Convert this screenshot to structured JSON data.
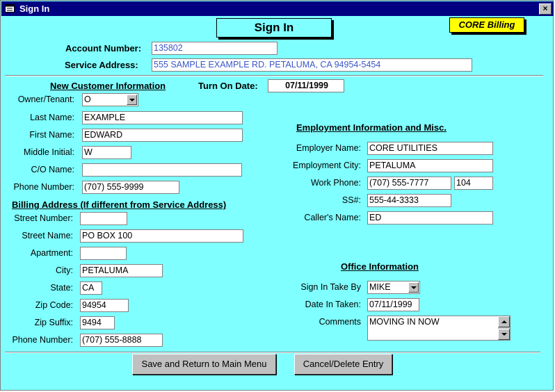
{
  "window": {
    "title": "Sign In",
    "close_glyph": "×",
    "app_icon": "form-icon"
  },
  "form": {
    "title": "Sign In",
    "badge": "CORE Billing"
  },
  "account": {
    "account_number_label": "Account Number:",
    "account_number": "135802",
    "service_address_label": "Service Address:",
    "service_address": "555 SAMPLE EXAMPLE RD. PETALUMA, CA  94954-5454"
  },
  "customer": {
    "heading": "New Customer Information",
    "turn_on_label": "Turn On Date:",
    "turn_on_date": "07/11/1999",
    "owner_tenant_label": "Owner/Tenant:",
    "owner_tenant": "O",
    "last_name_label": "Last Name:",
    "last_name": "EXAMPLE",
    "first_name_label": "First Name:",
    "first_name": "EDWARD",
    "middle_initial_label": "Middle Initial:",
    "middle_initial": "W",
    "co_name_label": "C/O Name:",
    "co_name": "",
    "phone_label": "Phone Number:",
    "phone": "(707) 555-9999"
  },
  "billing": {
    "heading": "Billing Address (If different from Service Address)",
    "street_number_label": "Street Number:",
    "street_number": "",
    "street_name_label": "Street Name:",
    "street_name": "PO BOX 100",
    "apartment_label": "Apartment:",
    "apartment": "",
    "city_label": "City:",
    "city": "PETALUMA",
    "state_label": "State:",
    "state": "CA",
    "zip_label": "Zip Code:",
    "zip": "94954",
    "zip_suffix_label": "Zip Suffix:",
    "zip_suffix": "9494",
    "phone_label": "Phone Number:",
    "phone": "(707) 555-8888"
  },
  "employment": {
    "heading": "Employment Information and Misc.",
    "employer_label": "Employer Name:",
    "employer": "CORE UTILITIES",
    "city_label": "Employment City:",
    "city": "PETALUMA",
    "work_phone_label": "Work Phone:",
    "work_phone": "(707) 555-7777",
    "extension": "104",
    "ssn_label": "SS#:",
    "ssn": "555-44-3333",
    "caller_label": "Caller's Name:",
    "caller": "ED"
  },
  "office": {
    "heading": "Office Information",
    "taken_by_label": "Sign In Take By",
    "taken_by": "MIKE",
    "date_taken_label": "Date In Taken:",
    "date_taken": "07/11/1999",
    "comments_label": "Comments",
    "comments": "MOVING IN NOW"
  },
  "buttons": {
    "save": "Save and Return to Main Menu",
    "cancel": "Cancel/Delete Entry"
  }
}
